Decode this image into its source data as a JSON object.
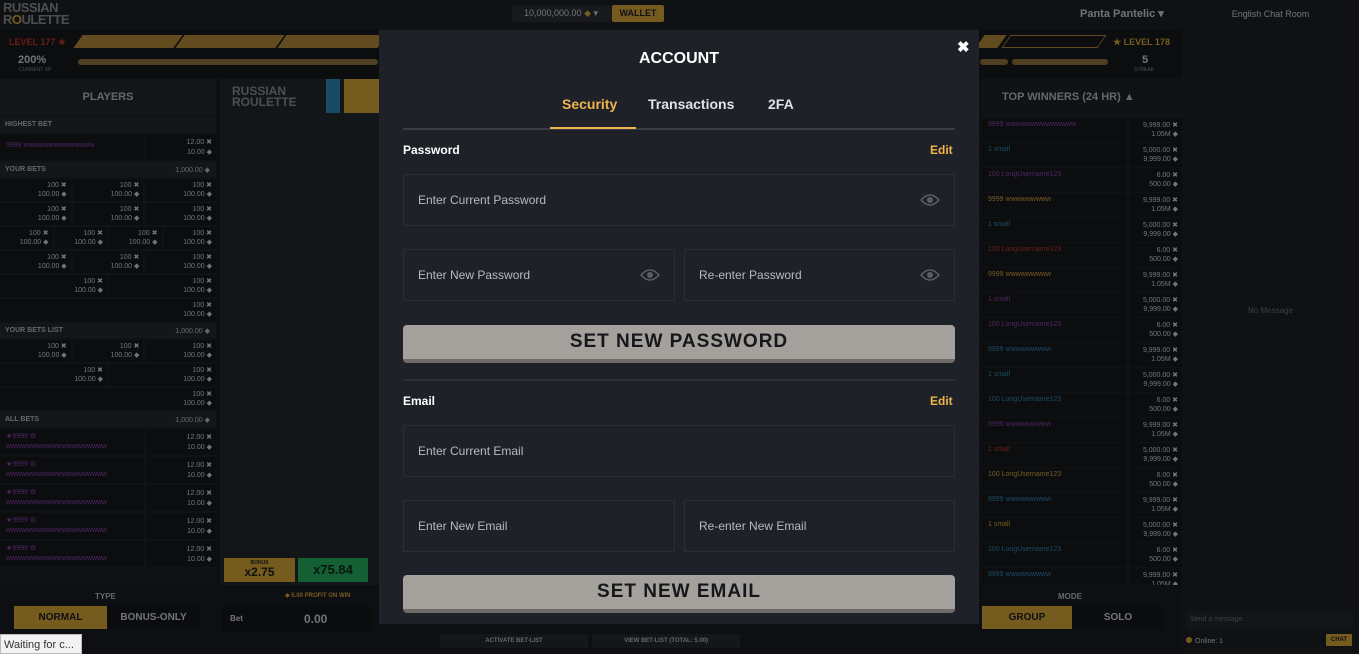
{
  "header": {
    "logo_line1": "RUSSIAN",
    "logo_line2_a": "R",
    "logo_line2_o": "O",
    "logo_line2_b": "ULETTE",
    "balance": "10,000,000.00",
    "wallet_label": "WALLET",
    "username": "Panta Pantelic"
  },
  "level": {
    "current": "LEVEL 177",
    "next": "LEVEL 178",
    "xp_percent": "200%",
    "xp_label": "CURRENT XP",
    "streak": "5",
    "streak_label": "STREAK"
  },
  "left": {
    "title": "PLAYERS",
    "highest_bet": "HIGHEST BET",
    "highest_user": "9999 wwwwwwwwwwwwww",
    "highest_vals": [
      "12.00",
      "10.00"
    ],
    "your_bets": "YOUR BETS",
    "your_bets_amt": "1,000.00",
    "your_bets_list": "YOUR BETS LIST",
    "your_bets_list_amt": "1,000.00",
    "all_bets": "ALL BETS",
    "all_bets_amt": "1,000.00",
    "cell_top": "100",
    "cell_bottom": "100.00",
    "all_user": "9999",
    "all_user_name": "wwwwwwwwwwwwwwwwwwww",
    "all_vals": [
      "12.00",
      "10.00"
    ]
  },
  "center": {
    "logo_line1": "RUSSIAN",
    "logo_line2": "ROULETTE",
    "bonus_label": "BONUS",
    "bonus_value": "x2.75",
    "multiplier": "x75.84",
    "profit_label": "5.00 PROFIT ON WIN",
    "bet_label": "Bet",
    "bet_value": "0.00",
    "activate_label": "ACTIVATE BET-LIST",
    "view_label": "VIEW BET-LIST (TOTAL: 5.00)"
  },
  "right": {
    "title": "TOP WINNERS (24 HR)",
    "rows": [
      {
        "who": "9999 wwwwwwwwwwwwww",
        "v1": "9,999.00",
        "v2": "1.05M",
        "color": "#8e44ad"
      },
      {
        "who": "1 small",
        "v1": "5,000.00",
        "v2": "9,999.00",
        "color": "#2f8ab7"
      },
      {
        "who": "100 LongUsername123",
        "v1": "6.00",
        "v2": "500.00",
        "color": "#8e44ad"
      },
      {
        "who": "9999 wwwwwwwww",
        "v1": "9,999.00",
        "v2": "1.05M",
        "color": "#d8a63a"
      },
      {
        "who": "1 small",
        "v1": "5,000.00",
        "v2": "9,999.00",
        "color": "#2f8ab7"
      },
      {
        "who": "100 LongUsername123",
        "v1": "6.00",
        "v2": "500.00",
        "color": "#c0392b"
      },
      {
        "who": "9999 wwwwwwwww",
        "v1": "9,999.00",
        "v2": "1.05M",
        "color": "#d8a63a"
      },
      {
        "who": "1 small",
        "v1": "5,000.00",
        "v2": "9,999.00",
        "color": "#8e44ad"
      },
      {
        "who": "100 LongUsername123",
        "v1": "6.00",
        "v2": "500.00",
        "color": "#8e44ad"
      },
      {
        "who": "9999 wwwwwwwww",
        "v1": "9,999.00",
        "v2": "1.05M",
        "color": "#2f8ab7"
      },
      {
        "who": "1 small",
        "v1": "5,000.00",
        "v2": "9,999.00",
        "color": "#2f8ab7"
      },
      {
        "who": "100 LongUsername123",
        "v1": "6.00",
        "v2": "500.00",
        "color": "#2f8ab7"
      },
      {
        "who": "9999 wwwwwwwww",
        "v1": "9,999.00",
        "v2": "1.05M",
        "color": "#8e44ad"
      },
      {
        "who": "1 small",
        "v1": "5,000.00",
        "v2": "9,999.00",
        "color": "#c0392b"
      },
      {
        "who": "100 LongUsername123",
        "v1": "6.00",
        "v2": "500.00",
        "color": "#d8a63a"
      },
      {
        "who": "9999 wwwwwwwww",
        "v1": "9,999.00",
        "v2": "1.05M",
        "color": "#2f8ab7"
      },
      {
        "who": "1 small",
        "v1": "5,000.00",
        "v2": "9,999.00",
        "color": "#d8a63a"
      },
      {
        "who": "100 LongUsername123",
        "v1": "6.00",
        "v2": "500.00",
        "color": "#2f8ab7"
      },
      {
        "who": "9999 wwwwwwwww",
        "v1": "9,999.00",
        "v2": "1.05M",
        "color": "#2f8ab7"
      }
    ]
  },
  "bottom": {
    "type_label": "TYPE",
    "normal": "NORMAL",
    "bonus_only": "BONUS-ONLY",
    "mode_label": "MODE",
    "group": "GROUP",
    "solo": "SOLO",
    "status": "Waiting for c..."
  },
  "chat": {
    "title": "English Chat Room",
    "empty": "No Message",
    "placeholder": "Send a message",
    "online": "Online: 1",
    "button": "CHAT"
  },
  "modal": {
    "title": "ACCOUNT",
    "close": "✖",
    "tabs": [
      "Security",
      "Transactions",
      "2FA"
    ],
    "password_label": "Password",
    "edit": "Edit",
    "current_password": "Enter Current Password",
    "new_password": "Enter New Password",
    "reenter_password": "Re-enter Password",
    "set_password": "SET NEW PASSWORD",
    "email_label": "Email",
    "current_email": "Enter Current Email",
    "new_email": "Enter New Email",
    "reenter_email": "Re-enter New Email",
    "set_email": "SET NEW EMAIL"
  },
  "colors": {
    "accent": "#f0b44c",
    "gold": "#d8a63a",
    "button": "#a4a09b",
    "green": "#27ae60"
  }
}
